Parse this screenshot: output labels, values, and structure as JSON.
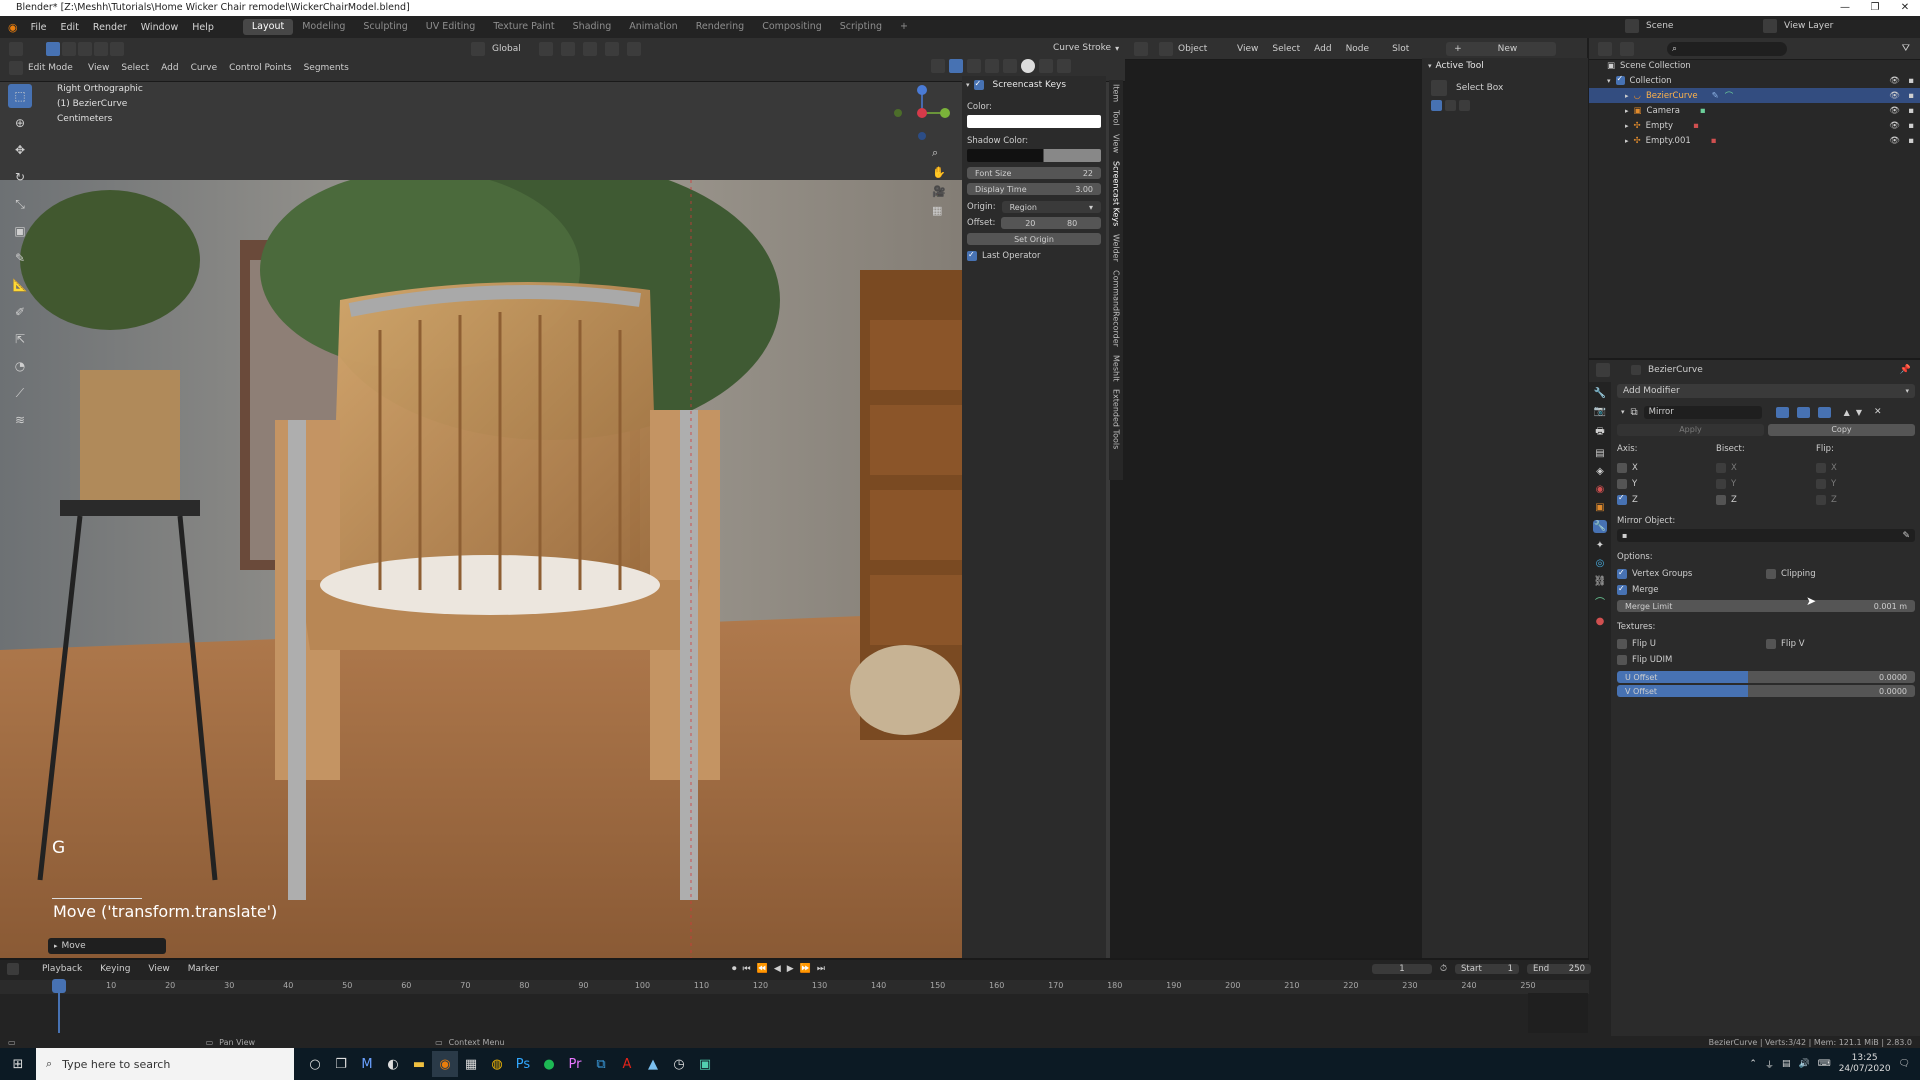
{
  "window": {
    "title": "Blender* [Z:\\Meshh\\Tutorials\\Home Wicker Chair remodel\\WickerChairModel.blend]",
    "controls": [
      "—",
      "❐",
      "✕"
    ]
  },
  "menus": [
    "File",
    "Edit",
    "Render",
    "Window",
    "Help"
  ],
  "workspaces": [
    "Layout",
    "Modeling",
    "Sculpting",
    "UV Editing",
    "Texture Paint",
    "Shading",
    "Animation",
    "Rendering",
    "Compositing",
    "Scripting"
  ],
  "topright": {
    "scene": "Scene",
    "view_layer": "View Layer"
  },
  "viewport": {
    "mode": "Edit Mode",
    "menus": [
      "View",
      "Select",
      "Add",
      "Curve",
      "Control Points",
      "Segments"
    ],
    "orientation": "Global",
    "curve_stroke": "Curve Stroke",
    "info": [
      "Right Orthographic",
      "(1) BezierCurve",
      "Centimeters"
    ],
    "key": "G",
    "operator": "Move ('transform.translate')",
    "last_op": "Move"
  },
  "npanel": {
    "title": "Screencast Keys",
    "color_label": "Color:",
    "shadow_label": "Shadow Color:",
    "font_size_label": "Font Size",
    "font_size": "22",
    "display_time_label": "Display Time",
    "display_time": "3.00",
    "origin_label": "Origin:",
    "origin": "Region",
    "offset_label": "Offset:",
    "offset_x": "20",
    "offset_y": "80",
    "set_origin": "Set Origin",
    "last_operator": "Last Operator",
    "tabs": [
      "Item",
      "Tool",
      "View",
      "Screencast Keys",
      "Welder",
      "CommandRecorder",
      "MeshIt",
      "Extended Tools"
    ]
  },
  "node_editor": {
    "type": "Object",
    "menus": [
      "View",
      "Select",
      "Add",
      "Node"
    ],
    "slot": "Slot",
    "new": "New"
  },
  "active_tool": {
    "title": "Active Tool",
    "tool": "Select Box"
  },
  "outliner": {
    "root": "Scene Collection",
    "items": [
      {
        "name": "Collection",
        "indent": 1
      },
      {
        "name": "BezierCurve",
        "indent": 2,
        "selected": true
      },
      {
        "name": "Camera",
        "indent": 2
      },
      {
        "name": "Empty",
        "indent": 2
      },
      {
        "name": "Empty.001",
        "indent": 2
      }
    ]
  },
  "properties": {
    "object": "BezierCurve",
    "add_modifier": "Add Modifier",
    "modifier_name": "Mirror",
    "apply": "Apply",
    "copy": "Copy",
    "axis_label": "Axis:",
    "bisect_label": "Bisect:",
    "flip_label": "Flip:",
    "axes": [
      "X",
      "Y",
      "Z"
    ],
    "axis_checked": [
      false,
      false,
      true
    ],
    "mirror_object_label": "Mirror Object:",
    "options_label": "Options:",
    "vertex_groups": "Vertex Groups",
    "clipping": "Clipping",
    "merge": "Merge",
    "merge_limit_label": "Merge Limit",
    "merge_limit": "0.001 m",
    "textures_label": "Textures:",
    "flip_u": "Flip U",
    "flip_v": "Flip V",
    "flip_udim": "Flip UDIM",
    "u_offset_label": "U Offset",
    "u_offset": "0.0000",
    "v_offset_label": "V Offset",
    "v_offset": "0.0000"
  },
  "timeline": {
    "menus": [
      "Playback",
      "Keying",
      "View",
      "Marker"
    ],
    "current": "1",
    "start_label": "Start",
    "start": "1",
    "end_label": "End",
    "end": "250",
    "ticks": [
      "1",
      "10",
      "20",
      "30",
      "40",
      "50",
      "60",
      "70",
      "80",
      "90",
      "100",
      "110",
      "120",
      "130",
      "140",
      "150",
      "160",
      "170",
      "180",
      "190",
      "200",
      "210",
      "220",
      "230",
      "240",
      "250"
    ]
  },
  "statusbar": {
    "pan": "Pan View",
    "context": "Context Menu",
    "stats": "BezierCurve | Verts:3/42 | Mem: 121.1 MiB | 2.83.0"
  },
  "taskbar": {
    "search": "Type here to search",
    "time": "13:25",
    "date": "24/07/2020"
  }
}
